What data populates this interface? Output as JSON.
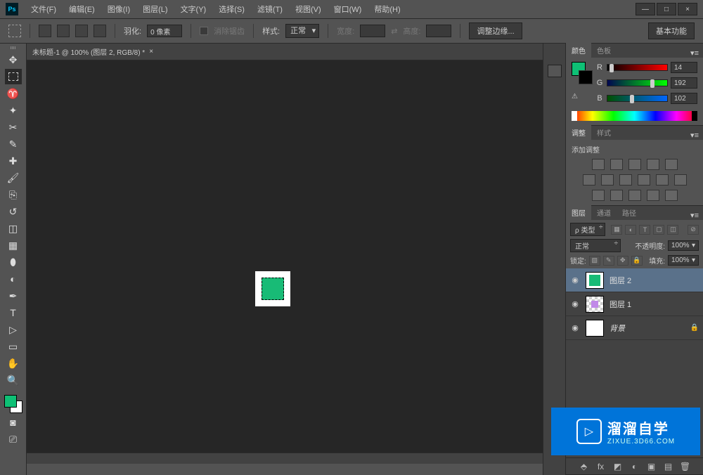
{
  "menu": [
    "文件(F)",
    "编辑(E)",
    "图像(I)",
    "图层(L)",
    "文字(Y)",
    "选择(S)",
    "滤镜(T)",
    "视图(V)",
    "窗口(W)",
    "帮助(H)"
  ],
  "window_controls": {
    "min": "—",
    "max": "□",
    "close": "×"
  },
  "options": {
    "feather_label": "羽化:",
    "feather_value": "0 像素",
    "antialias_label": "消除锯齿",
    "style_label": "样式:",
    "style_value": "正常",
    "width_label": "宽度:",
    "height_label": "高度:",
    "width_value": "",
    "height_value": "",
    "refine_edge": "调整边缘...",
    "workspace": "基本功能"
  },
  "doc_tab": {
    "title": "未标题-1 @ 100% (图层 2, RGB/8) *"
  },
  "color_panel": {
    "tab_color": "颜色",
    "tab_swatch": "色板",
    "r_label": "R",
    "g_label": "G",
    "b_label": "B",
    "r": "14",
    "g": "192",
    "b": "102",
    "warning": "⚠"
  },
  "adjust_panel": {
    "tab_adjust": "调整",
    "tab_styles": "样式",
    "add_label": "添加调整"
  },
  "layers_panel": {
    "tab_layers": "图层",
    "tab_channels": "通道",
    "tab_paths": "路径",
    "filter_label": "ρ 类型",
    "blend_mode": "正常",
    "opacity_label": "不透明度:",
    "opacity_value": "100%",
    "lock_label": "锁定:",
    "fill_label": "填充:",
    "fill_value": "100%",
    "layers": [
      {
        "name": "图层 2",
        "selected": true,
        "thumb": "green"
      },
      {
        "name": "图层 1",
        "selected": false,
        "thumb": "purple"
      },
      {
        "name": "背景",
        "selected": false,
        "thumb": "white",
        "locked": true
      }
    ]
  },
  "watermark": {
    "text": "溜溜自学",
    "url": "ZIXUE.3D66.COM"
  }
}
